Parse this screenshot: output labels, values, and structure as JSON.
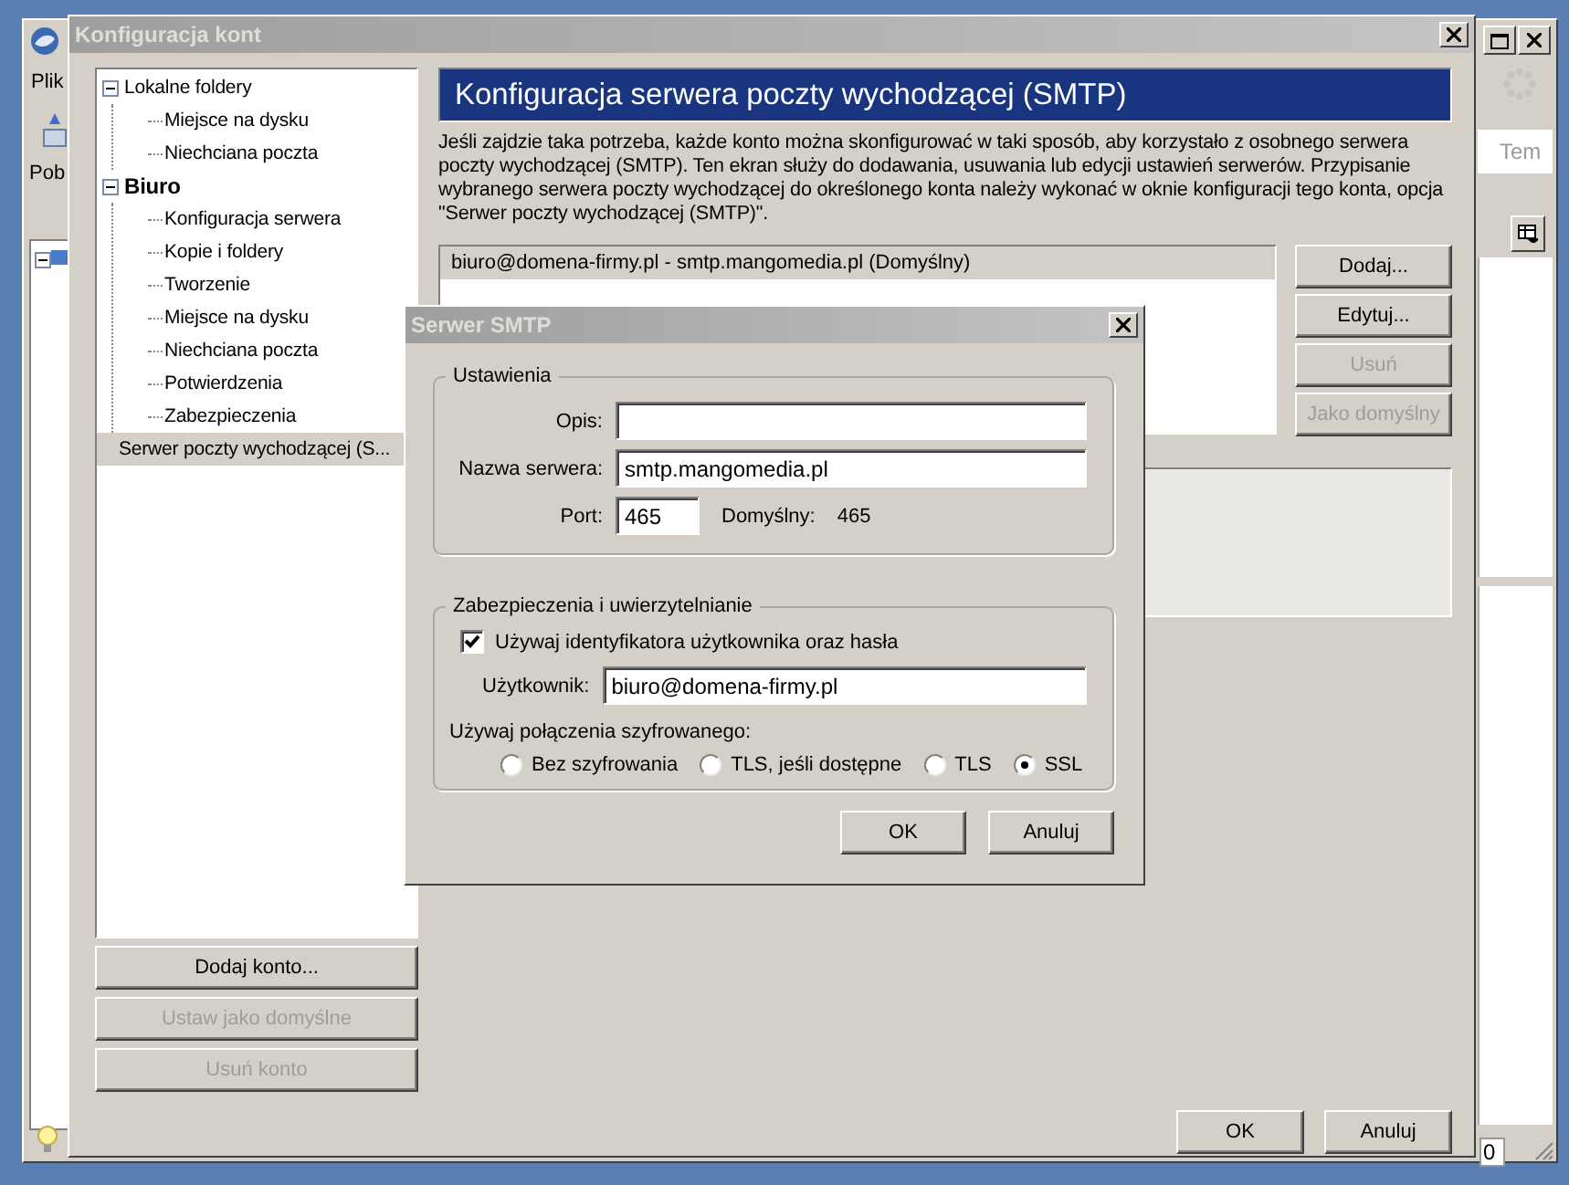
{
  "background_window": {
    "menu": "Plik",
    "toolbar_label": "Pob",
    "search_placeholder": "Tem",
    "status_text": "0"
  },
  "accounts_dialog": {
    "title": "Konfiguracja kont",
    "tree": [
      {
        "label": "Lokalne foldery",
        "kind": "local",
        "expanded": true,
        "selected": false,
        "children": [
          {
            "label": "Miejsce na dysku",
            "selected": false
          },
          {
            "label": "Niechciana poczta",
            "selected": false
          }
        ]
      },
      {
        "label": "Biuro",
        "kind": "account",
        "expanded": true,
        "selected": false,
        "children": [
          {
            "label": "Konfiguracja serwera",
            "selected": false
          },
          {
            "label": "Kopie i foldery",
            "selected": false
          },
          {
            "label": "Tworzenie",
            "selected": false
          },
          {
            "label": "Miejsce na dysku",
            "selected": false
          },
          {
            "label": "Niechciana poczta",
            "selected": false
          },
          {
            "label": "Potwierdzenia",
            "selected": false
          },
          {
            "label": "Zabezpieczenia",
            "selected": false
          }
        ]
      },
      {
        "label": "Serwer poczty wychodzącej (S...",
        "kind": "smtp",
        "selected": true
      }
    ],
    "account_buttons": [
      {
        "label": "Dodaj konto...",
        "disabled": false
      },
      {
        "label": "Ustaw jako domyślne",
        "disabled": true
      },
      {
        "label": "Usuń konto",
        "disabled": true
      }
    ],
    "panel": {
      "title": "Konfiguracja serwera poczty wychodzącej (SMTP)",
      "description": "Jeśli zajdzie taka potrzeba, każde konto można skonfigurować w taki sposób, aby korzystało z osobnego serwera poczty wychodzącej (SMTP). Ten ekran służy do dodawania, usuwania lub edycji ustawień serwerów. Przypisanie wybranego serwera poczty wychodzącej do określonego konta należy wykonać w oknie konfiguracji tego konta, opcja \"Serwer poczty wychodzącej (SMTP)\".",
      "servers": [
        {
          "label": "biuro@domena-firmy.pl - smtp.mangomedia.pl (Domyślny)",
          "selected": true
        }
      ],
      "buttons": [
        {
          "label": "Dodaj...",
          "disabled": false
        },
        {
          "label": "Edytuj...",
          "disabled": false
        },
        {
          "label": "Usuń",
          "disabled": true
        },
        {
          "label": "Jako domyślny",
          "disabled": true
        }
      ]
    },
    "footer_buttons": [
      "OK",
      "Anuluj"
    ]
  },
  "smtp_dialog": {
    "title": "Serwer SMTP",
    "settings": {
      "legend": "Ustawienia",
      "description_label": "Opis:",
      "server_label": "Nazwa serwera:",
      "server_value": "smtp.mangomedia.pl",
      "port_label": "Port:",
      "port_value": "465",
      "default_label": "Domyślny:",
      "default_value": "465"
    },
    "security": {
      "legend": "Zabezpieczenia i uwierzytelnianie",
      "auth": {
        "label": "Używaj identyfikatora użytkownika oraz hasła",
        "checked": true
      },
      "user_label": "Użytkownik:",
      "user_value": "biuro@domena-firmy.pl",
      "encryption_label": "Używaj połączenia szyfrowanego:",
      "encryption": [
        {
          "label": "Bez szyfrowania",
          "selected": false
        },
        {
          "label": "TLS, jeśli dostępne",
          "selected": false
        },
        {
          "label": "TLS",
          "selected": false
        },
        {
          "label": "SSL",
          "selected": true
        }
      ]
    },
    "buttons": [
      "OK",
      "Anuluj"
    ]
  }
}
